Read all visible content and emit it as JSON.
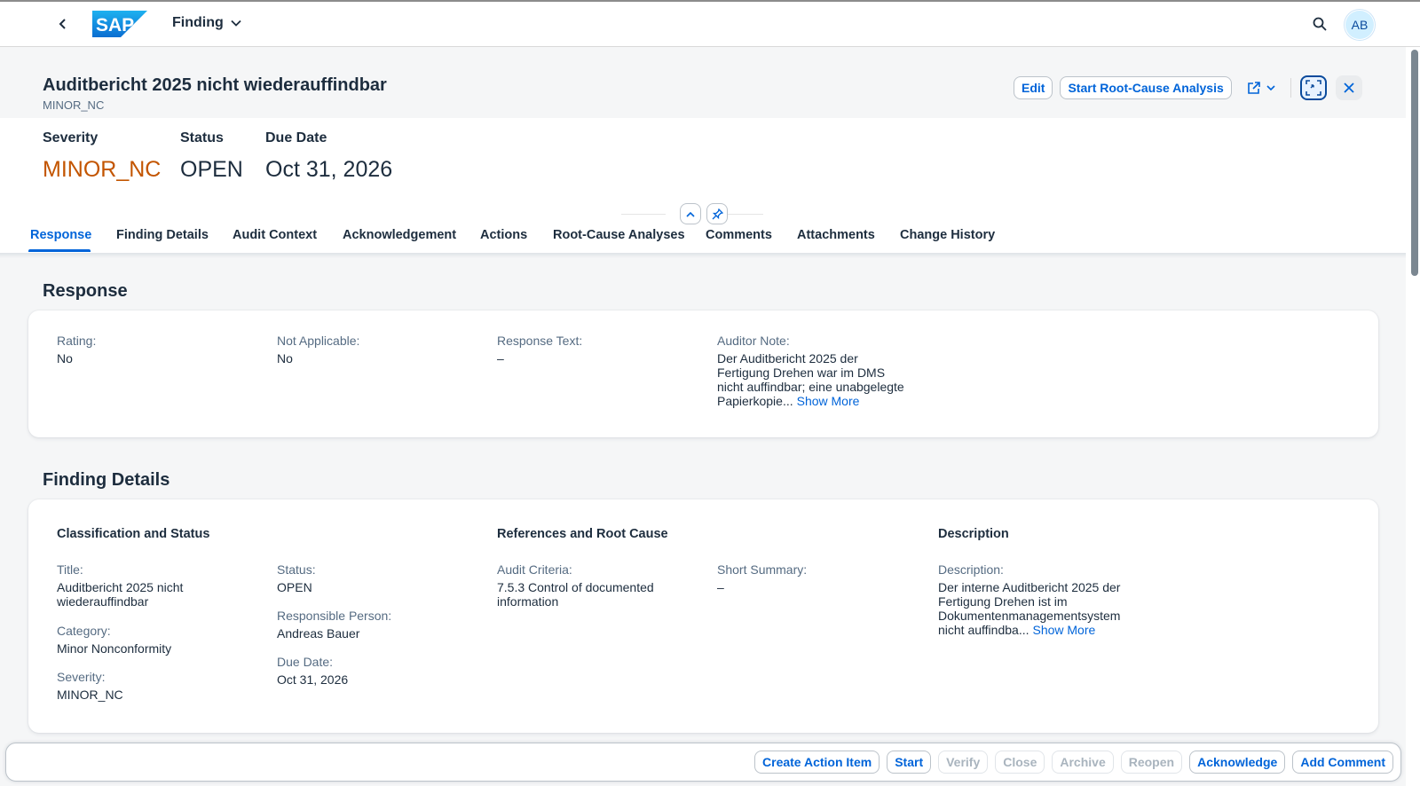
{
  "shell": {
    "logo_text": "SAP",
    "app_title": "Finding",
    "avatar_initials": "AB"
  },
  "header": {
    "title": "Auditbericht 2025 nicht wiederauffindbar",
    "subtitle": "MINOR_NC",
    "actions": {
      "edit": "Edit",
      "start_rca": "Start Root-Cause Analysis"
    }
  },
  "kpis": {
    "severity_label": "Severity",
    "severity_value": "MINOR_NC",
    "status_label": "Status",
    "status_value": "OPEN",
    "due_label": "Due Date",
    "due_value": "Oct 31, 2026"
  },
  "tabs": [
    "Response",
    "Finding Details",
    "Audit Context",
    "Acknowledgement",
    "Actions",
    "Root-Cause Analyses",
    "Comments",
    "Attachments",
    "Change History"
  ],
  "active_tab": "Response",
  "response": {
    "title": "Response",
    "rating_label": "Rating:",
    "rating_value": "No",
    "na_label": "Not Applicable:",
    "na_value": "No",
    "text_label": "Response Text:",
    "text_value": "–",
    "note_label": "Auditor Note:",
    "note_value": "Der Auditbericht 2025 der Fertigung Drehen war im DMS nicht auffindbar; eine unabgelegte Papierkopie...",
    "show_more": "Show More"
  },
  "finding_details": {
    "title": "Finding Details",
    "group_classification": "Classification and Status",
    "group_references": "References and Root Cause",
    "group_description": "Description",
    "title_label": "Title:",
    "title_value": "Auditbericht 2025 nicht wiederauffindbar",
    "category_label": "Category:",
    "category_value": "Minor Nonconformity",
    "severity_label": "Severity:",
    "severity_value": "MINOR_NC",
    "status_label": "Status:",
    "status_value": "OPEN",
    "responsible_label": "Responsible Person:",
    "responsible_value": "Andreas Bauer",
    "due_label": "Due Date:",
    "due_value": "Oct 31, 2026",
    "criteria_label": "Audit Criteria:",
    "criteria_value": "7.5.3 Control of documented information",
    "summary_label": "Short Summary:",
    "summary_value": "–",
    "description_label": "Description:",
    "description_value": "Der interne Auditbericht 2025 der Fertigung Drehen ist im Dokumentenmanagementsystem nicht auffindba...",
    "show_more": "Show More"
  },
  "next_section_title": "Audit Context",
  "footer": {
    "create_action_item": "Create Action Item",
    "start": "Start",
    "verify": "Verify",
    "close": "Close",
    "archive": "Archive",
    "reopen": "Reopen",
    "acknowledge": "Acknowledge",
    "add_comment": "Add Comment"
  },
  "colors": {
    "accent": "#0064d9",
    "warning": "#c35500",
    "text": "#1d2d3e",
    "label": "#556b82"
  }
}
